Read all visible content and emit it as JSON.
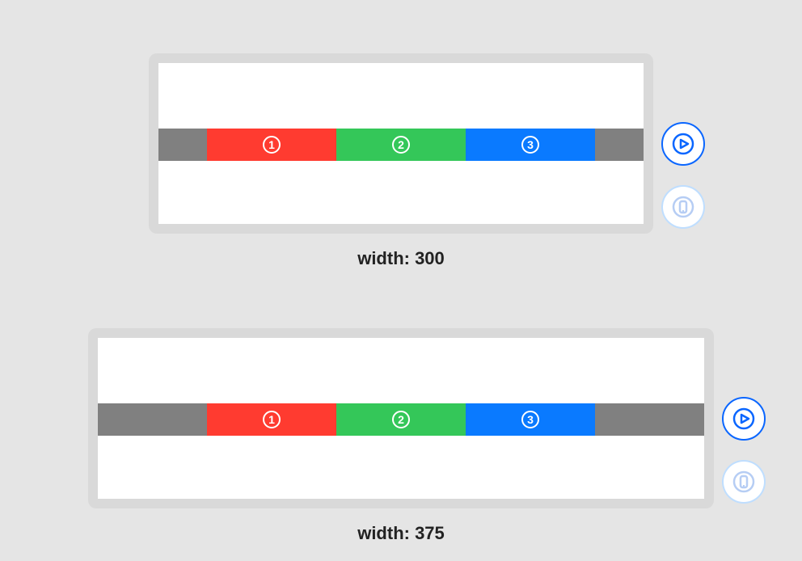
{
  "examples": [
    {
      "caption": "width: 300",
      "tabs": [
        "1",
        "2",
        "3"
      ],
      "colors": [
        "#ff3b30",
        "#34c759",
        "#0a7aff"
      ]
    },
    {
      "caption": "width: 375",
      "tabs": [
        "1",
        "2",
        "3"
      ],
      "colors": [
        "#ff3b30",
        "#34c759",
        "#0a7aff"
      ]
    }
  ],
  "controls": {
    "play_label": "play",
    "device_label": "device"
  }
}
